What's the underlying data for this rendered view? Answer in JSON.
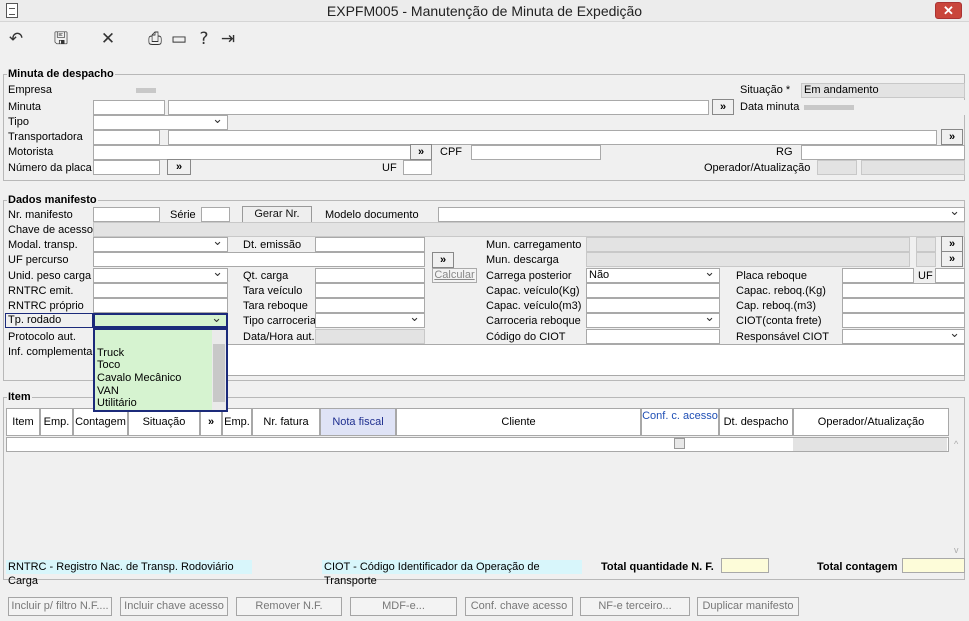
{
  "window": {
    "title": "EXPFM005 - Manutenção de Minuta de Expedição",
    "close": "✕"
  },
  "toolbar": {
    "icons": {
      "undo": "↶",
      "save": "🖫",
      "cancel": "✕",
      "print": "⎙",
      "calendar": "▭",
      "help": "?",
      "exit": "⇥"
    }
  },
  "minuta": {
    "title": "Minuta de despacho",
    "empresa_label": "Empresa",
    "minuta_label": "Minuta",
    "tipo_label": "Tipo",
    "transportadora_label": "Transportadora",
    "motorista_label": "Motorista",
    "placa_label": "Número da placa",
    "situacao_label": "Situação *",
    "situacao_value": "Em andamento",
    "data_minuta_label": "Data minuta",
    "cpf_label": "CPF",
    "rg_label": "RG",
    "uf_label": "UF",
    "operador_label": "Operador/Atualização",
    "expand": "»"
  },
  "manifesto": {
    "title": "Dados manifesto",
    "nr_manifesto": "Nr. manifesto",
    "serie": "Série",
    "gerar_nr": "Gerar Nr.",
    "modelo_documento": "Modelo documento",
    "chave_acesso": "Chave de acesso",
    "modal_transp": "Modal. transp.",
    "uf_percurso": "UF percurso",
    "unid_peso": "Unid. peso carga",
    "rntrc_emit": "RNTRC emit.",
    "rntrc_proprio": "RNTRC próprio",
    "tp_rodado": "Tp. rodado",
    "protocolo": "Protocolo aut.",
    "inf_complementar": "Inf. complementar",
    "dt_emissao": "Dt. emissão",
    "qt_carga": "Qt. carga",
    "tara_veiculo": "Tara veículo",
    "tara_reboque": "Tara reboque",
    "tipo_carroceria": "Tipo carroceria",
    "data_hora_aut": "Data/Hora aut.",
    "calcular": "Calcular",
    "mun_carregamento": "Mun. carregamento",
    "mun_descarga": "Mun. descarga",
    "carrega_posterior": "Carrega posterior",
    "carrega_posterior_value": "Não",
    "capac_veiculo_kg": "Capac. veículo(Kg)",
    "capac_veiculo_m3": "Capac. veículo(m3)",
    "carroceria_reboque": "Carroceria reboque",
    "codigo_ciot": "Código do CIOT",
    "placa_reboque": "Placa reboque",
    "uf": "UF",
    "capac_reboq_kg": "Capac. reboq.(Kg)",
    "cap_reboq_m3": "Cap. reboq.(m3)",
    "ciot_conta_frete": "CIOT(conta frete)",
    "responsavel_ciot": "Responsável CIOT",
    "tp_rodado_options": [
      "Truck",
      "Toco",
      "Cavalo Mecânico",
      "VAN",
      "Utilitário"
    ]
  },
  "item": {
    "title": "Item",
    "columns": [
      "Item",
      "Emp.",
      "Contagem",
      "Situação",
      "»",
      "Emp.",
      "Nr. fatura",
      "Nota fiscal",
      "Cliente",
      "Conf. c. acesso",
      "Dt. despacho",
      "Operador/Atualização"
    ],
    "legend_rntrc": "RNTRC - Registro Nac. de Transp. Rodoviário Carga",
    "legend_ciot": "CIOT - Código Identificador da Operação de Transporte",
    "total_qtd_nf": "Total quantidade N. F.",
    "total_contagem": "Total contagem"
  },
  "buttons": [
    "Incluir p/ filtro N.F....",
    "Incluir chave acesso",
    "Remover N.F.",
    "MDF-e...",
    "Conf. chave acesso",
    "NF-e terceiro...",
    "Duplicar manifesto"
  ]
}
